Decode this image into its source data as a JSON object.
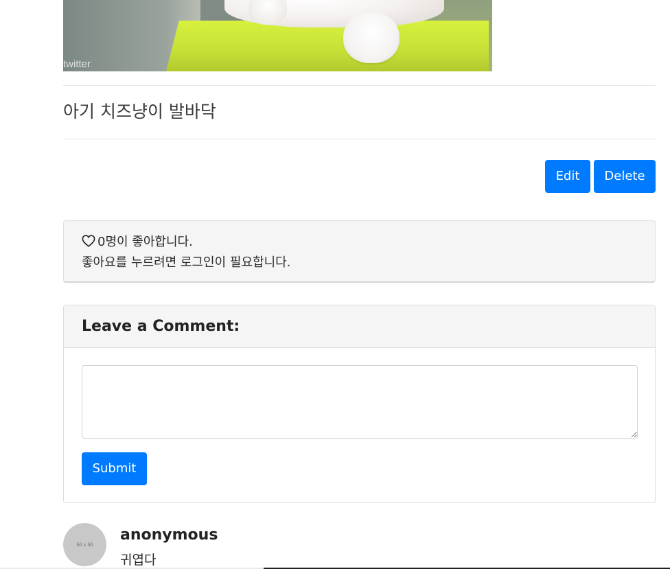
{
  "image": {
    "watermark": "twitter"
  },
  "post": {
    "title": "아기 치즈냥이 발바닥"
  },
  "actions": {
    "edit_label": "Edit",
    "delete_label": "Delete"
  },
  "likes": {
    "icon": "heart-outline-icon",
    "count_text": "0명이 좋아합니다.",
    "login_notice": "좋아요를 누르려면 로그인이 필요합니다."
  },
  "comment_form": {
    "heading": "Leave a Comment:",
    "textarea_value": "",
    "submit_label": "Submit"
  },
  "comments": [
    {
      "avatar_text": "60 x 60",
      "author": "anonymous",
      "body": "귀엽다"
    }
  ],
  "colors": {
    "primary": "#007bff",
    "card_bg": "#f5f5f5"
  }
}
